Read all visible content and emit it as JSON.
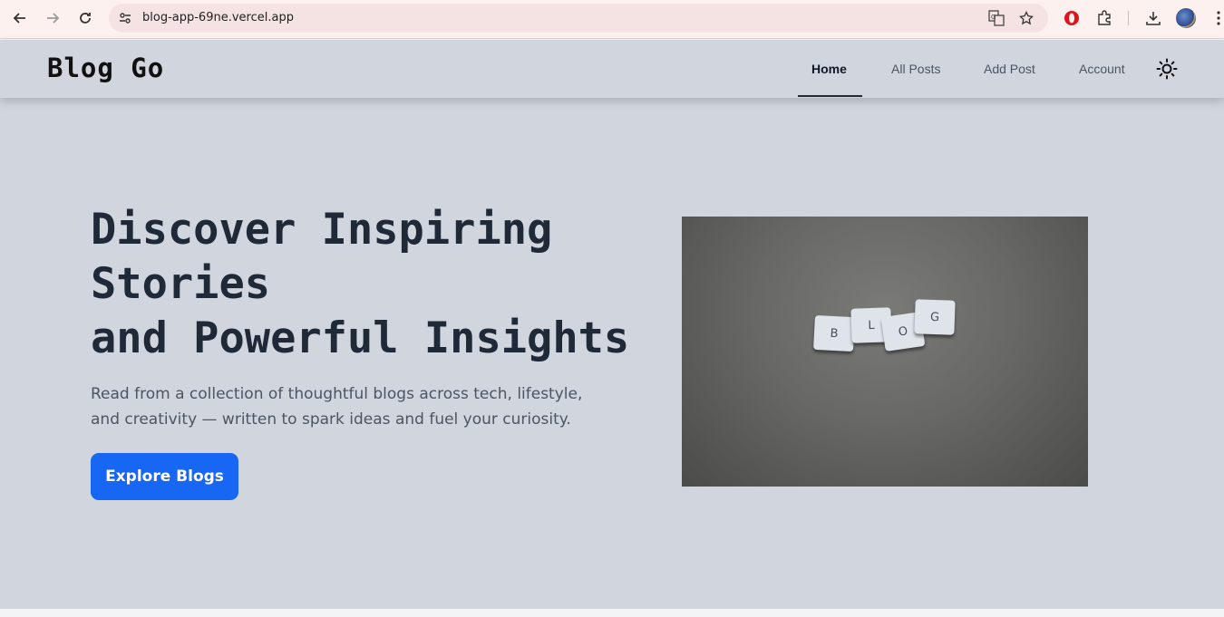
{
  "browser": {
    "url": "blog-app-69ne.vercel.app",
    "back_icon": "arrow-left-icon",
    "forward_icon": "arrow-right-icon",
    "reload_icon": "reload-icon"
  },
  "header": {
    "logo": "Blog Go",
    "nav": [
      {
        "label": "Home",
        "active": true
      },
      {
        "label": "All Posts",
        "active": false
      },
      {
        "label": "Add Post",
        "active": false
      },
      {
        "label": "Account",
        "active": false
      }
    ],
    "theme_icon": "sun-icon"
  },
  "hero": {
    "title_lines": [
      "Discover Inspiring",
      "Stories",
      "and Powerful Insights"
    ],
    "description": "Read from a collection of thoughtful blogs across tech, lifestyle, and creativity — written to spark ideas and fuel your curiosity.",
    "cta_label": "Explore Blogs",
    "image_tiles": [
      "B",
      "L",
      "O",
      "G"
    ]
  },
  "colors": {
    "accent": "#1766f4",
    "hero_bg": "#d1d5de",
    "heading": "#1f2937"
  }
}
